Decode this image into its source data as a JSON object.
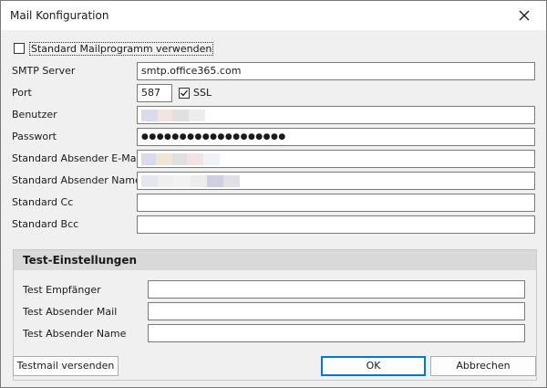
{
  "window": {
    "title": "Mail Konfiguration",
    "close_label": "Close"
  },
  "use_default_mail": {
    "label": "Standard Mailprogramm verwenden",
    "checked": false
  },
  "fields": {
    "smtp_server": {
      "label": "SMTP Server",
      "value": "smtp.office365.com"
    },
    "port": {
      "label": "Port",
      "value": "587"
    },
    "ssl": {
      "label": "SSL",
      "checked": true
    },
    "user": {
      "label": "Benutzer",
      "value": ""
    },
    "password": {
      "label": "Passwort",
      "value": "●●●●●●●●●●●●●●●●●●●"
    },
    "sender_email": {
      "label": "Standard Absender E-Mail",
      "value": ""
    },
    "sender_name": {
      "label": "Standard Absender Name",
      "value": ""
    },
    "cc": {
      "label": "Standard Cc",
      "value": ""
    },
    "bcc": {
      "label": "Standard Bcc",
      "value": ""
    }
  },
  "test": {
    "heading": "Test-Einstellungen",
    "recipient": {
      "label": "Test Empfänger",
      "value": ""
    },
    "sender_mail": {
      "label": "Test Absender Mail",
      "value": ""
    },
    "sender_name": {
      "label": "Test Absender Name",
      "value": ""
    }
  },
  "buttons": {
    "send_test": "Testmail versenden",
    "ok": "OK",
    "cancel": "Abbrechen"
  },
  "colors": {
    "accent": "#0078d7",
    "check_color": "#1a1a1a",
    "redaction": [
      "#d9dbe8",
      "#f3e4e4",
      "#e0e0e0",
      "#f0e6d8",
      "#e6e6ef",
      "#cfcfe0"
    ]
  }
}
